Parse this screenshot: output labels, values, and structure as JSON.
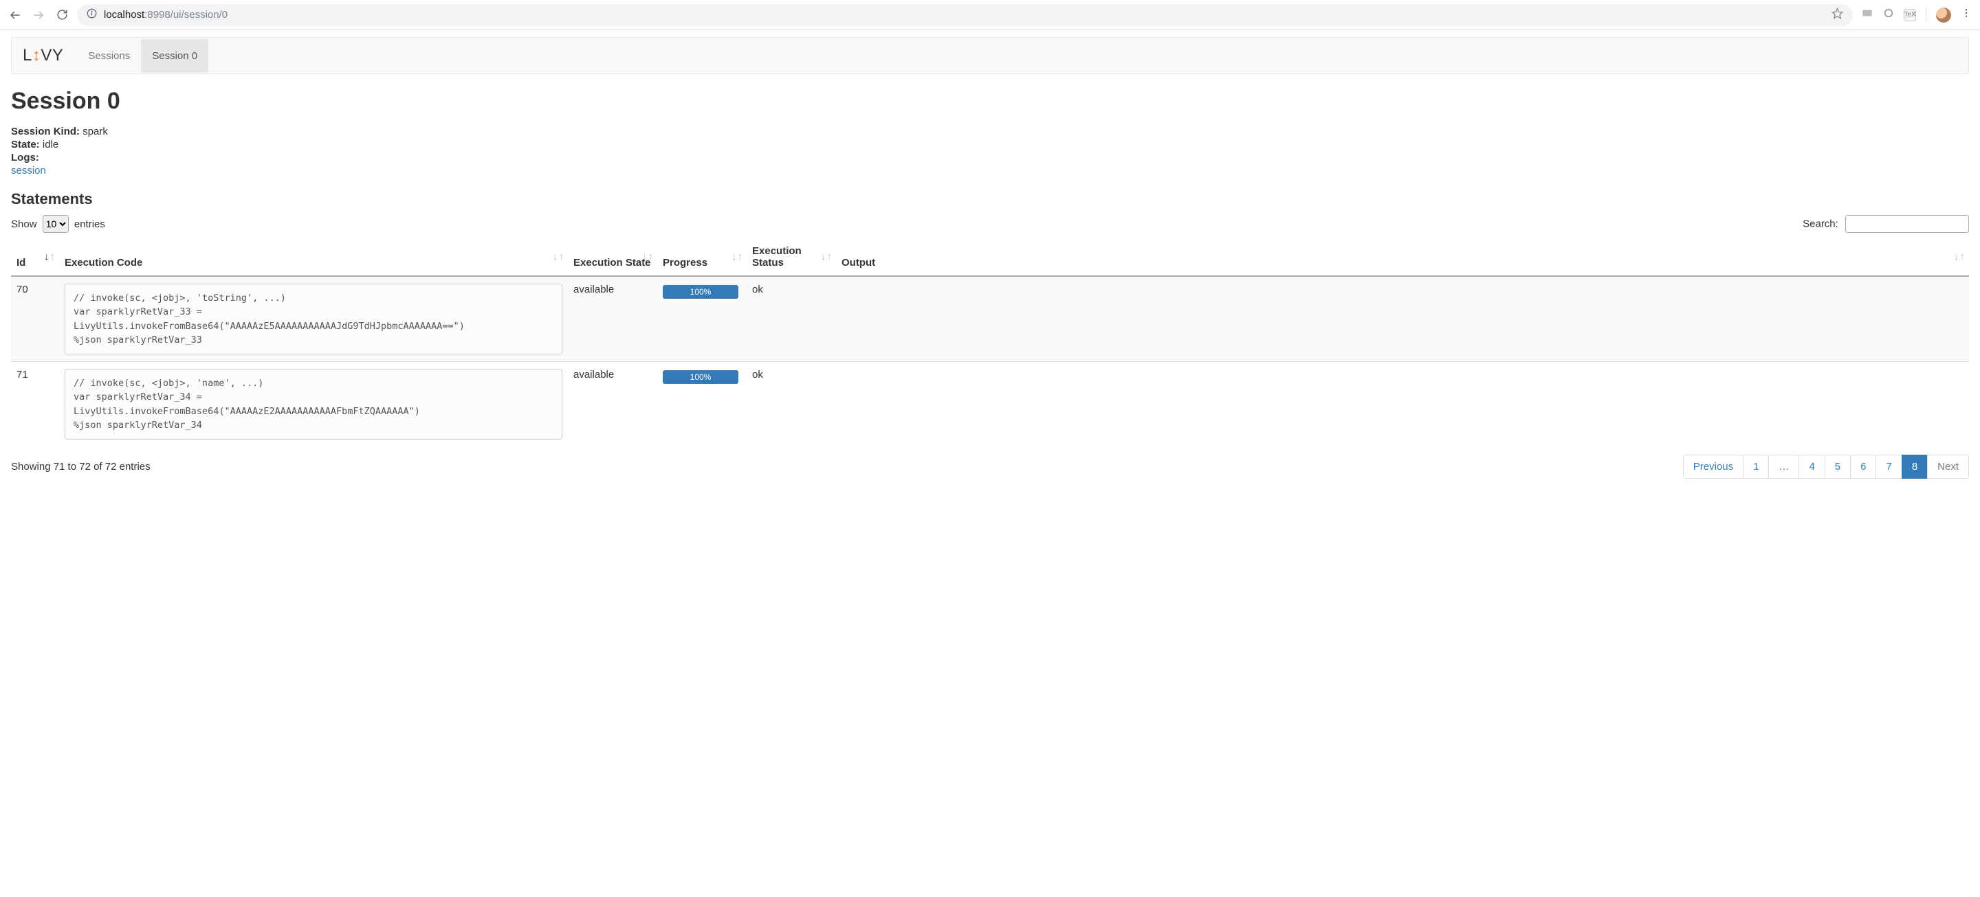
{
  "browser": {
    "url_host": "localhost",
    "url_port_path": ":8998/ui/session/0"
  },
  "nav": {
    "logo_l": "L",
    "logo_arrow": "↕",
    "logo_vy": "VY",
    "sessions": "Sessions",
    "session0": "Session 0"
  },
  "page": {
    "title": "Session 0",
    "kind_label": "Session Kind:",
    "kind_value": "spark",
    "state_label": "State:",
    "state_value": "idle",
    "logs_label": "Logs:",
    "logs_link": "session",
    "statements_heading": "Statements"
  },
  "dt": {
    "show_label": "Show",
    "entries_label": "entries",
    "length_value": "10",
    "search_label": "Search:",
    "columns": {
      "id": "Id",
      "code": "Execution Code",
      "state": "Execution State",
      "progress": "Progress",
      "status": "Execution Status",
      "output": "Output"
    },
    "rows": [
      {
        "id": "70",
        "code": "// invoke(sc, <jobj>, 'toString', ...)\nvar sparklyrRetVar_33 = LivyUtils.invokeFromBase64(\"AAAAAzE5AAAAAAAAAAAJdG9TdHJpbmcAAAAAAA==\")\n%json sparklyrRetVar_33",
        "state": "available",
        "progress": "100%",
        "status": "ok",
        "output": ""
      },
      {
        "id": "71",
        "code": "// invoke(sc, <jobj>, 'name', ...)\nvar sparklyrRetVar_34 = LivyUtils.invokeFromBase64(\"AAAAAzE2AAAAAAAAAAAFbmFtZQAAAAAA\")\n%json sparklyrRetVar_34",
        "state": "available",
        "progress": "100%",
        "status": "ok",
        "output": ""
      }
    ],
    "info": "Showing 71 to 72 of 72 entries",
    "pagination": {
      "previous": "Previous",
      "pages": [
        "1",
        "…",
        "4",
        "5",
        "6",
        "7",
        "8"
      ],
      "active": "8",
      "next": "Next"
    }
  }
}
